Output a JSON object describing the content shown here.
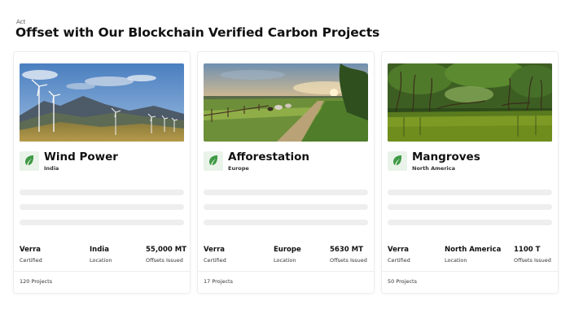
{
  "header": {
    "eyebrow": "Act",
    "title": "Offset with Our Blockchain Verified Carbon Projects"
  },
  "icon": "leaf-icon",
  "colors": {
    "leaf": "#3f9a45",
    "leaf_bg": "#eaf3ea",
    "skeleton": "#eeeeee"
  },
  "cards": [
    {
      "title": "Wind Power",
      "region": "India",
      "image": "wind-turbines-photo",
      "stats": [
        {
          "value": "Verra",
          "label": "Certified"
        },
        {
          "value": "India",
          "label": "Location"
        },
        {
          "value": "55,000 MT",
          "label": "Offsets Issued"
        }
      ],
      "footer": "120 Projects"
    },
    {
      "title": "Afforestation",
      "region": "Europe",
      "image": "countryside-sunset-photo",
      "stats": [
        {
          "value": "Verra",
          "label": "Certified"
        },
        {
          "value": "Europe",
          "label": "Location"
        },
        {
          "value": "5630 MT",
          "label": "Offsets Issued"
        }
      ],
      "footer": "17 Projects"
    },
    {
      "title": "Mangroves",
      "region": "North America",
      "image": "mangrove-forest-photo",
      "stats": [
        {
          "value": "Verra",
          "label": "Certified"
        },
        {
          "value": "North America",
          "label": "Location"
        },
        {
          "value": "1100 T",
          "label": "Offsets Issued"
        }
      ],
      "footer": "50 Projects"
    }
  ]
}
